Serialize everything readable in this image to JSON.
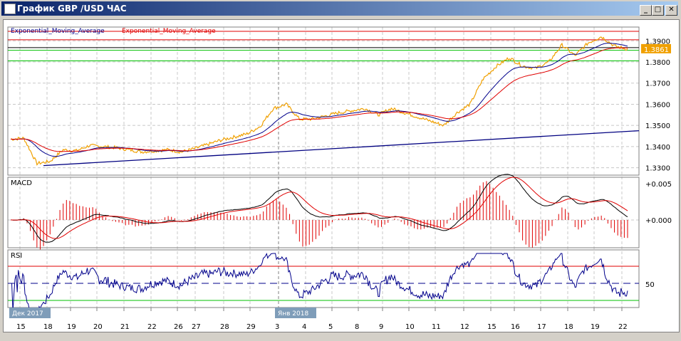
{
  "window": {
    "title": "График GBP /USD  ЧАС",
    "minimize": "_",
    "maximize": "□",
    "close": "✕"
  },
  "legend": {
    "ema_fast": "Exponential_Moving_Average",
    "ema_slow": "Exponential_Moving_Average"
  },
  "colors": {
    "price": "#f0a000",
    "ema_fast": "#00008b",
    "ema_slow": "#e00000",
    "trend": "#000080",
    "green": "#00c000"
  },
  "price_axis": {
    "labels": [
      "1.3900",
      "1.3800",
      "1.3700",
      "1.3600",
      "1.3500",
      "1.3400",
      "1.3300"
    ],
    "current": "1.3861"
  },
  "macd": {
    "title": "MACD",
    "labels": [
      "+0.005",
      "+0.000"
    ]
  },
  "rsi": {
    "title": "RSI",
    "labels": [
      "50"
    ]
  },
  "time_axis": {
    "days": [
      "15",
      "18",
      "19",
      "20",
      "21",
      "22",
      "26",
      "27",
      "28",
      "29",
      "3",
      "4",
      "5",
      "8",
      "9",
      "10",
      "11",
      "12",
      "15",
      "16",
      "17",
      "18",
      "19",
      "22"
    ],
    "month_labels": [
      "Дек 2017",
      "Янв 2018"
    ]
  },
  "chart_data": {
    "type": "line",
    "title": "GBP/USD hourly",
    "ylim": [
      1.3265,
      1.3965
    ],
    "price": [
      1.3435,
      1.344,
      1.332,
      1.333,
      1.3385,
      1.338,
      1.3405,
      1.34,
      1.3395,
      1.3385,
      1.3375,
      1.338,
      1.3385,
      1.3375,
      1.339,
      1.341,
      1.343,
      1.3445,
      1.346,
      1.3495,
      1.358,
      1.36,
      1.353,
      1.353,
      1.3545,
      1.356,
      1.357,
      1.358,
      1.355,
      1.358,
      1.356,
      1.354,
      1.352,
      1.35,
      1.356,
      1.36,
      1.372,
      1.378,
      1.382,
      1.378,
      1.377,
      1.38,
      1.388,
      1.383,
      1.389,
      1.392,
      1.3875,
      1.3861
    ],
    "trendline": [
      1.331,
      1.3475
    ],
    "levels": [
      {
        "value": 1.3945,
        "color": "#e00000"
      },
      {
        "value": 1.3905,
        "color": "#e00000"
      },
      {
        "value": 1.3868,
        "color": "#000000"
      },
      {
        "value": 1.3855,
        "color": "#00c000"
      },
      {
        "value": 1.3805,
        "color": "#00c000"
      }
    ],
    "rsi_levels": [
      70,
      50,
      30
    ]
  }
}
